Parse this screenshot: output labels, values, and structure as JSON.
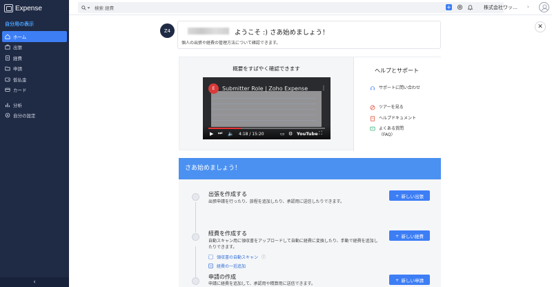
{
  "app": {
    "name": "Expense"
  },
  "sidebar": {
    "section_label": "自分用の表示",
    "items": [
      {
        "label": "ホーム",
        "icon": "home-icon",
        "active": true
      },
      {
        "label": "出張",
        "icon": "suitcase-icon"
      },
      {
        "label": "経費",
        "icon": "receipt-icon"
      },
      {
        "label": "申請",
        "icon": "folder-icon"
      },
      {
        "label": "仮払金",
        "icon": "wallet-icon"
      },
      {
        "label": "カード",
        "icon": "card-icon"
      },
      {
        "label": "分析",
        "icon": "chart-icon"
      },
      {
        "label": "自分の設定",
        "icon": "settings-icon"
      }
    ],
    "collapse_glyph": "‹"
  },
  "topbar": {
    "search_placeholder": "検索 経費",
    "org_name": "株式会社ワッ…",
    "add_glyph": "+"
  },
  "welcome": {
    "logo_text": "Z4",
    "title": "ようこそ :) さあ始めましょう！",
    "subtitle": "個人の出張や経費の管理方法について確認できます。"
  },
  "overview": {
    "title": "概要をすばやく確認できます",
    "video": {
      "title": "Submitter Role | Zoho Expense",
      "time": "4:18 / 15:20",
      "brand": "YouTube",
      "progress": 0.28
    }
  },
  "help": {
    "title": "ヘルプとサポート",
    "items": [
      {
        "label": "サポートに問い合わせ",
        "icon": "headset-icon"
      },
      {
        "label": "ツアーを見る",
        "icon": "tour-icon"
      },
      {
        "label": "ヘルプドキュメント",
        "icon": "document-icon"
      },
      {
        "label": "よくある質問（FAQ）",
        "icon": "faq-icon"
      }
    ]
  },
  "getting_started": {
    "title": "さあ始めましょう！",
    "steps": [
      {
        "title": "出張を作成する",
        "desc": "出張申請を行ったり、旅程を追加したり、承認用に送信したりできます。",
        "button": "新しい出張"
      },
      {
        "title": "経費を作成する",
        "desc": "自動スキャン用に領収書をアップロードして自動に経費に変換したり、手動で経費を追加したりできます。",
        "button": "新しい経費",
        "links": [
          "領収書の自動スキャン",
          "経費の一括追加"
        ]
      },
      {
        "title": "申請の作成",
        "desc": "申請に経費を追加して、承認用や精算用に送信できます。",
        "button": "新しい申請"
      }
    ]
  },
  "colors": {
    "sidebar": "#1f2a44",
    "accent": "#3d7ef5",
    "banner": "#4b91f1"
  }
}
